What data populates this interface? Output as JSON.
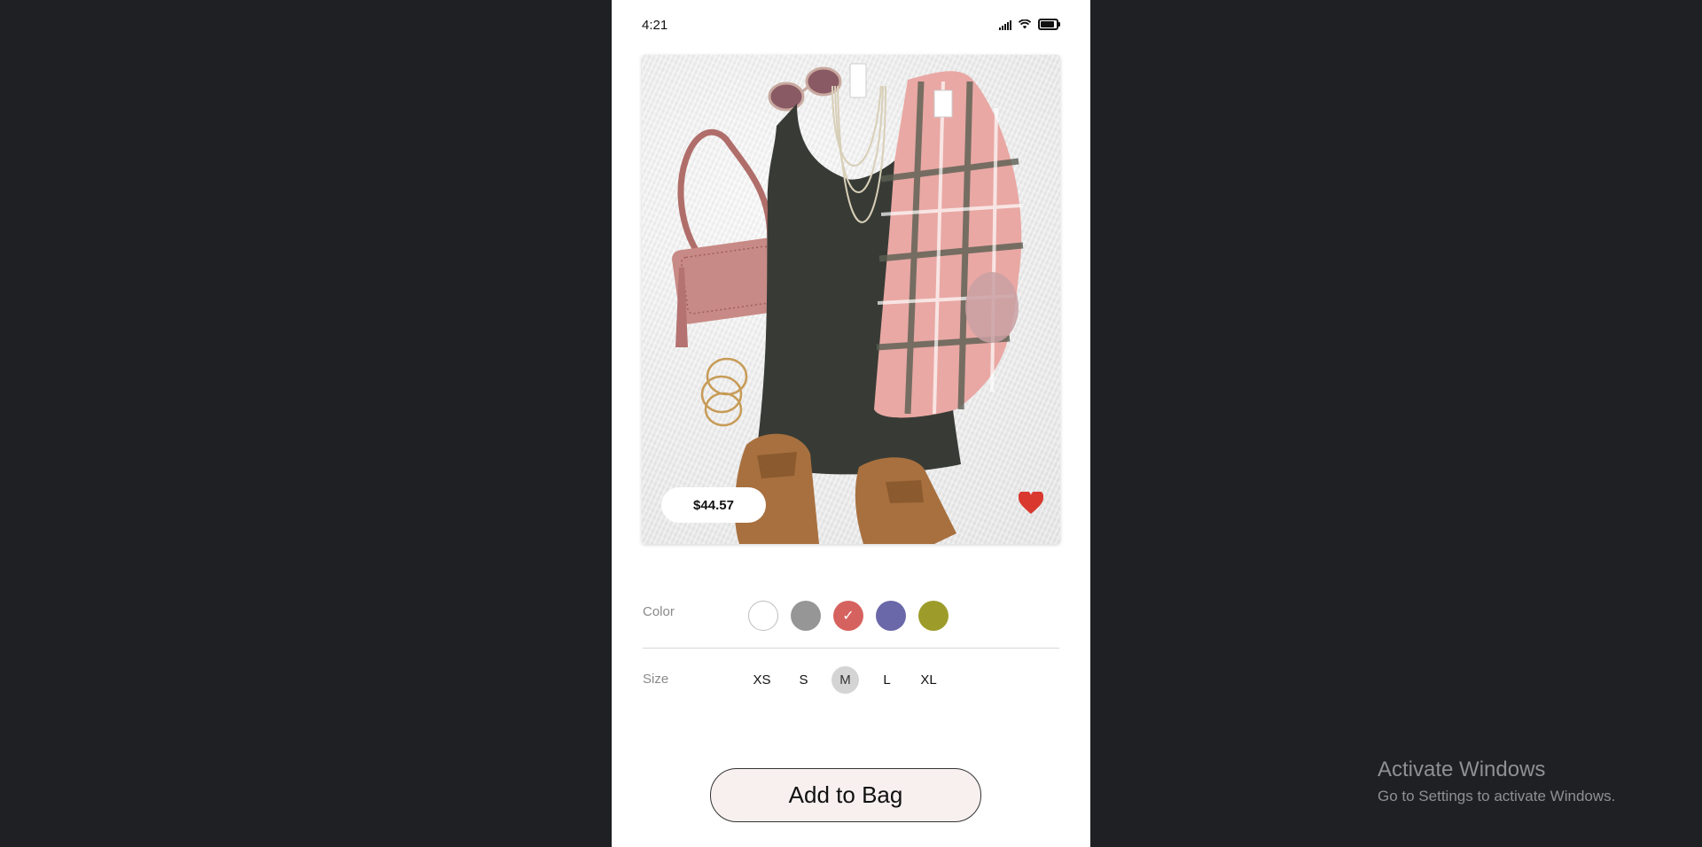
{
  "status_bar": {
    "time": "4:21",
    "icons": [
      "signal-icon",
      "wifi-icon",
      "battery-icon"
    ]
  },
  "product": {
    "price": "$44.57",
    "favorite_icon": "heart-icon",
    "favorited": true,
    "heart_color": "#d9382e",
    "image_description_icon": "outfit-photo"
  },
  "color_option": {
    "label": "Color",
    "swatches": [
      {
        "color": "#ffffff",
        "selected": false
      },
      {
        "color": "#969696",
        "selected": false
      },
      {
        "color": "#d6625f",
        "selected": true
      },
      {
        "color": "#6a68a8",
        "selected": false
      },
      {
        "color": "#9d9c2a",
        "selected": false
      }
    ],
    "check_icon": "✓"
  },
  "size_option": {
    "label": "Size",
    "sizes": [
      "XS",
      "S",
      "M",
      "L",
      "XL"
    ],
    "selected": "M"
  },
  "actions": {
    "add_to_bag_label": "Add to Bag"
  },
  "os_watermark": {
    "title": "Activate Windows",
    "subtitle": "Go to Settings to activate Windows."
  }
}
